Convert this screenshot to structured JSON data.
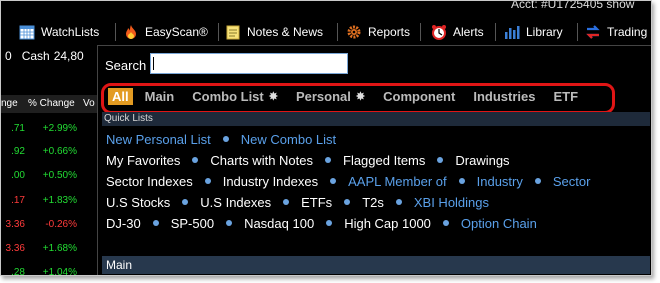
{
  "toolbar": {
    "account_text": "Acct: #U1725405 show",
    "items": [
      {
        "label": "WatchLists",
        "icon": "grid-calendar-icon"
      },
      {
        "label": "EasyScan®",
        "icon": "flame-icon"
      },
      {
        "label": "Notes & News",
        "icon": "notepad-icon"
      },
      {
        "label": "Reports",
        "icon": "gear-icon"
      },
      {
        "label": "Alerts",
        "icon": "alarm-clock-icon"
      },
      {
        "label": "Library",
        "icon": "bar-chart-icon"
      },
      {
        "label": "Trading",
        "icon": "swap-arrows-icon"
      }
    ]
  },
  "watchlist": {
    "cash_prefix": "0",
    "cash_label": "Cash",
    "cash_value": "24,80",
    "col_change": "nge",
    "col_pct_change": "% Change",
    "col_vol": "Vo",
    "rows": [
      {
        "change": ".71",
        "pct": "+2.99%",
        "dir": "up"
      },
      {
        "change": ".92",
        "pct": "+0.66%",
        "dir": "up"
      },
      {
        "change": ".00",
        "pct": "+0.50%",
        "dir": "up"
      },
      {
        "change": ".17",
        "pct": "+1.83%",
        "dir": "up"
      },
      {
        "change": "3.36",
        "pct": "-0.26%",
        "dir": "down"
      },
      {
        "change": "3.36",
        "pct": "+1.68%",
        "dir": "up"
      },
      {
        "change": ".28",
        "pct": "+1.04%",
        "dir": "up"
      }
    ]
  },
  "dialog": {
    "search_label": "Search",
    "search_value": "",
    "tabs": [
      {
        "label": "All",
        "active": true,
        "star": false
      },
      {
        "label": "Main",
        "active": false,
        "star": false
      },
      {
        "label": "Combo List",
        "active": false,
        "star": true
      },
      {
        "label": "Personal",
        "active": false,
        "star": true
      },
      {
        "label": "Component",
        "active": false,
        "star": false
      },
      {
        "label": "Industries",
        "active": false,
        "star": false
      },
      {
        "label": "ETF",
        "active": false,
        "star": false
      }
    ],
    "star_glyph": "✸",
    "quick_lists_header": "Quick Lists",
    "main_header": "Main",
    "quick_rows": [
      [
        {
          "label": "New Personal List",
          "link": true
        },
        {
          "label": "New Combo List",
          "link": true
        }
      ],
      [
        {
          "label": "My Favorites",
          "link": false
        },
        {
          "label": "Charts with Notes",
          "link": false
        },
        {
          "label": "Flagged Items",
          "link": false
        },
        {
          "label": "Drawings",
          "link": false
        }
      ],
      [
        {
          "label": "Sector Indexes",
          "link": false
        },
        {
          "label": "Industry Indexes",
          "link": false
        },
        {
          "label": "AAPL Member of",
          "link": true
        },
        {
          "label": "Industry",
          "link": true
        },
        {
          "label": "Sector",
          "link": true
        }
      ],
      [
        {
          "label": "U.S Stocks",
          "link": false
        },
        {
          "label": "U.S Indexes",
          "link": false
        },
        {
          "label": "ETFs",
          "link": false
        },
        {
          "label": "T2s",
          "link": false
        },
        {
          "label": "XBI Holdings",
          "link": true
        }
      ],
      [
        {
          "label": "DJ-30",
          "link": false
        },
        {
          "label": "SP-500",
          "link": false
        },
        {
          "label": "Nasdaq 100",
          "link": false
        },
        {
          "label": "High Cap 1000",
          "link": false
        },
        {
          "label": "Option Chain",
          "link": true
        }
      ]
    ]
  },
  "colors": {
    "active_tab": "#e39b22",
    "highlight_border": "#e01515",
    "link_blue": "#5aa0ea",
    "gain_green": "#22dd33",
    "loss_red": "#ff3b3b"
  }
}
